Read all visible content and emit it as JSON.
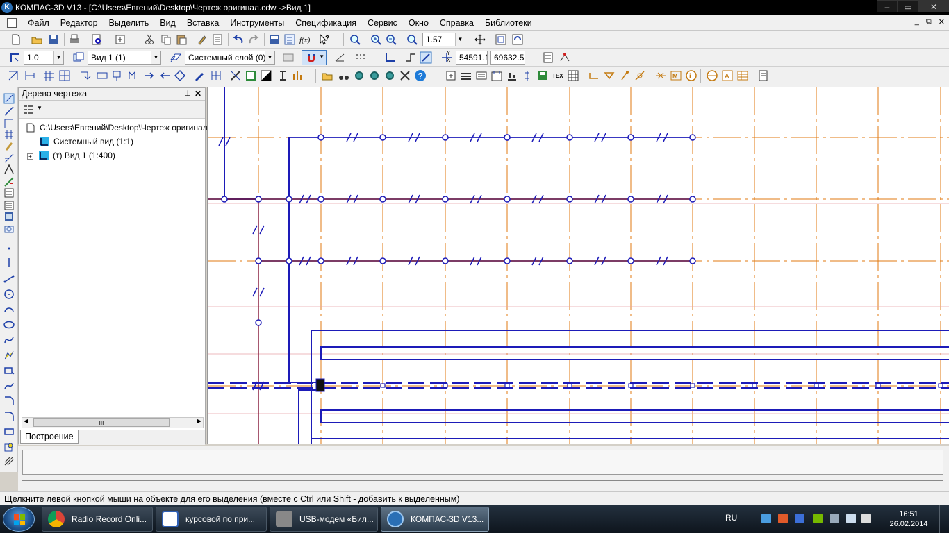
{
  "window": {
    "title": "КОМПАС-3D V13 - [C:\\Users\\Евгений\\Desktop\\Чертеж оригинал.cdw ->Вид 1]",
    "logo_letter": "K"
  },
  "menu": {
    "items": [
      "Файл",
      "Редактор",
      "Выделить",
      "Вид",
      "Вставка",
      "Инструменты",
      "Спецификация",
      "Сервис",
      "Окно",
      "Справка",
      "Библиотеки"
    ],
    "mdi_buttons": [
      "_",
      "⧉",
      "✕"
    ]
  },
  "toolbar1": {
    "zoom_value": "1.57"
  },
  "toolbar2": {
    "step_value": "1.0",
    "view_value": "Вид 1 (1)",
    "layer_value": "Системный слой (0)",
    "coord_y_label": "Y",
    "coord_x_label": "X",
    "coord_x": "54591.1",
    "coord_y": "69632.5"
  },
  "tree_panel": {
    "title": "Дерево чертежа",
    "pin_glyph": "⊥",
    "close_glyph": "✕",
    "items": [
      {
        "label": "C:\\Users\\Евгений\\Desktop\\Чертеж оригинал.cdw",
        "icon": "document-icon"
      },
      {
        "label": "Системный вид (1:1)",
        "icon": "view-icon"
      },
      {
        "label": "(т) Вид 1 (1:400)",
        "icon": "view-icon",
        "expander": "+"
      }
    ],
    "scroll_grip": "III",
    "tab_label": "Построение"
  },
  "status": {
    "hint": "Щелкните левой кнопкой мыши на объекте для его выделения (вместе с Ctrl или Shift - добавить к выделенным)"
  },
  "taskbar": {
    "tasks": [
      {
        "label": "Radio Record Onli...",
        "icon": "chrome-icon",
        "color": "#e04a2f"
      },
      {
        "label": "курсовой по при...",
        "icon": "word-icon",
        "color": "#2f5fb3"
      },
      {
        "label": "USB-модем «Бил...",
        "icon": "modem-icon",
        "color": "#6e6e6e"
      },
      {
        "label": "КОМПАС-3D V13...",
        "icon": "kompas-icon",
        "color": "#2a6fb5",
        "active": true
      }
    ],
    "lang": "RU",
    "time": "16:51",
    "date": "26.02.2014"
  },
  "colors": {
    "drawing_blue": "#1d1bb8",
    "axis_orange": "#e07a10",
    "accent_pink": "#e8a0a8"
  }
}
